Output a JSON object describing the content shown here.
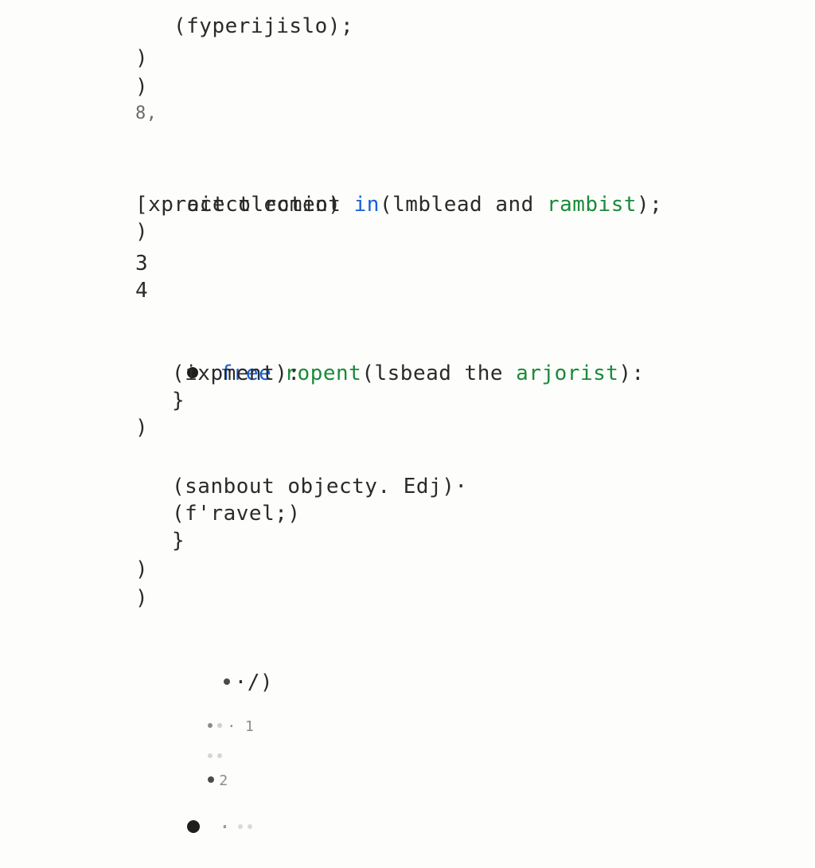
{
  "code": {
    "l1": "(fyperijislo);",
    "l2": ")",
    "l3": ")",
    "l4": "8,",
    "l5_a": "oiect roment ",
    "l5_b": "in",
    "l5_c": "(lmblead and ",
    "l5_d": "rambist",
    "l5_e": ");",
    "l6": "[xpract olectio)",
    "l7": ")",
    "l8": "3",
    "l9": "4",
    "l10_a": "free",
    "l10_b": " ropent",
    "l10_c": "(lsbead the ",
    "l10_d": "arjorist",
    "l10_e": "):",
    "l11": "(ixpment):",
    "l12": "}",
    "l13": ")",
    "l14": "(sanbout objecty. Edj)·",
    "l15": "(f'ravel;)",
    "l16": "}",
    "l17": ")",
    "l18": ")",
    "l19": "·/)",
    "l20": "· 1",
    "l21": "·",
    "l22": "2",
    "l23": "·"
  }
}
